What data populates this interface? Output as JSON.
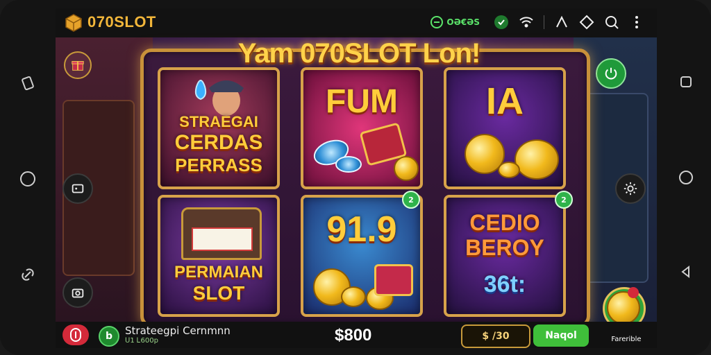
{
  "status": {
    "brand": "070SLOT",
    "pill_text": "OƏ€ƏS",
    "icons": [
      "network-icon",
      "wifi-icon",
      "signal-icon",
      "search-icon",
      "more-icon"
    ]
  },
  "hero": {
    "banner": "Yam 070SLOT Lon!"
  },
  "tiles": [
    {
      "title_lines": [
        "STRAEGAI",
        "CERDAS",
        "PERRASS"
      ]
    },
    {
      "title_lines": [
        "FUM"
      ]
    },
    {
      "title_lines": [
        "IA"
      ]
    },
    {
      "title_lines": [
        "PERMAIAN",
        "SLOT"
      ]
    },
    {
      "title_lines": [
        "91.9"
      ]
    },
    {
      "title_lines": [
        "CEDIO",
        "BEROY",
        "36t:"
      ]
    }
  ],
  "tile_badges": [
    "2",
    "2"
  ],
  "bottom": {
    "label": "Strateegpi Cernmnn",
    "sublabel": "ᑌ1 Ꮮ600p",
    "amount": "$800",
    "bet": "$ /30",
    "go_label": "Naqol",
    "fav_label": "Farerible"
  },
  "colors": {
    "accent_gold": "#f2b63a",
    "go_green": "#3fbf3a",
    "stop_red": "#d42a3a"
  }
}
